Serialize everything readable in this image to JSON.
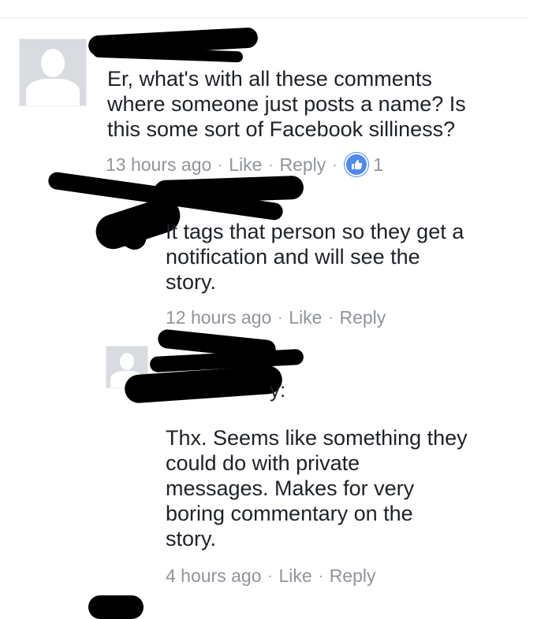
{
  "comments": [
    {
      "text": "Er, what's with all these comments\nwhere someone just posts a name? Is\nthis some sort of Facebook silliness?",
      "time": "13 hours ago",
      "like_label": "Like",
      "reply_label": "Reply",
      "reaction_count": "1"
    },
    {
      "text": "It tags that person so they get a\nnotification and will see the\nstory.",
      "time": "12 hours ago",
      "like_label": "Like",
      "reply_label": "Reply"
    },
    {
      "name_suffix": "y:",
      "text": "Thx. Seems like something they\ncould do with private\nmessages. Makes for very\nboring commentary on the\nstory.",
      "time": "4 hours ago",
      "like_label": "Like",
      "reply_label": "Reply"
    }
  ],
  "colors": {
    "meta_text": "#90949c",
    "like_badge": "#4e8af0",
    "avatar_bg": "#d8dbe0",
    "redaction": "#000000"
  }
}
